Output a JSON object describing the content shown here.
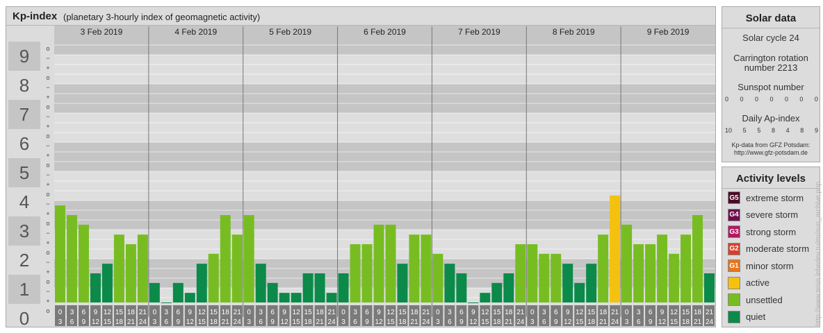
{
  "header": {
    "title": "Kp-index",
    "subtitle": "(planetary 3-hourly index of geomagnetic activity)"
  },
  "kp_labels": [
    "0",
    "1",
    "2",
    "3",
    "4",
    "5",
    "6",
    "7",
    "8",
    "9"
  ],
  "subdivision_marks": [
    "o",
    "+",
    "−",
    "o"
  ],
  "chart_data": {
    "type": "bar",
    "title": "Kp-index",
    "days": [
      "3 Feb 2019",
      "4 Feb 2019",
      "5 Feb 2019",
      "6 Feb 2019",
      "7 Feb 2019",
      "8 Feb 2019",
      "9 Feb 2019"
    ],
    "hour_ranges": [
      [
        "0",
        "3"
      ],
      [
        "3",
        "6"
      ],
      [
        "6",
        "9"
      ],
      [
        "9",
        "12"
      ],
      [
        "12",
        "15"
      ],
      [
        "15",
        "18"
      ],
      [
        "18",
        "21"
      ],
      [
        "21",
        "24"
      ]
    ],
    "values": [
      [
        3.33,
        3.0,
        2.67,
        1.0,
        1.33,
        2.33,
        2.0,
        2.33
      ],
      [
        0.67,
        0.0,
        0.67,
        0.33,
        1.33,
        1.67,
        3.0,
        2.33
      ],
      [
        3.0,
        1.33,
        0.67,
        0.33,
        0.33,
        1.0,
        1.0,
        0.33
      ],
      [
        1.0,
        2.0,
        2.0,
        2.67,
        2.67,
        1.33,
        2.33,
        2.33
      ],
      [
        1.67,
        1.33,
        1.0,
        0.0,
        0.33,
        0.67,
        1.0,
        2.0
      ],
      [
        2.0,
        1.67,
        1.67,
        1.33,
        0.67,
        1.33,
        2.33,
        3.67
      ],
      [
        2.67,
        2.0,
        2.0,
        2.33,
        1.67,
        2.33,
        3.0,
        1.0
      ]
    ],
    "ylim": [
      0,
      9
    ],
    "colors": {
      "quiet": "#0b8a4a",
      "unsettled": "#77bd22",
      "active": "#f4c10f"
    }
  },
  "solar": {
    "title": "Solar data",
    "cycle": "Solar cycle 24",
    "carrington_line1": "Carrington rotation",
    "carrington_line2": "number 2213",
    "sunspot_label": "Sunspot number",
    "sunspot_values": [
      "0",
      "0",
      "0",
      "0",
      "0",
      "0",
      "0"
    ],
    "ap_label": "Daily Ap-index",
    "ap_values": [
      "10",
      "5",
      "5",
      "8",
      "4",
      "8",
      "9"
    ],
    "source_line1": "Kp-data from GFZ Potsdam:",
    "source_line2": "http://www.gfz-potsdam.de"
  },
  "activity": {
    "title": "Activity levels",
    "levels": [
      {
        "code": "G5",
        "label": "extreme storm",
        "color": "#4a0a26"
      },
      {
        "code": "G4",
        "label": "severe storm",
        "color": "#6d0d4c"
      },
      {
        "code": "G3",
        "label": "strong storm",
        "color": "#b3185e"
      },
      {
        "code": "G2",
        "label": "moderate storm",
        "color": "#d6402a"
      },
      {
        "code": "G1",
        "label": "minor storm",
        "color": "#e6761e"
      },
      {
        "code": "",
        "label": "active",
        "color": "#f4c10f"
      },
      {
        "code": "",
        "label": "unsettled",
        "color": "#77bd22"
      },
      {
        "code": "",
        "label": "quiet",
        "color": "#0b8a4a"
      }
    ]
  },
  "watermark": "http://www.tesis.lebedev.ru/en/sun_archive.php"
}
